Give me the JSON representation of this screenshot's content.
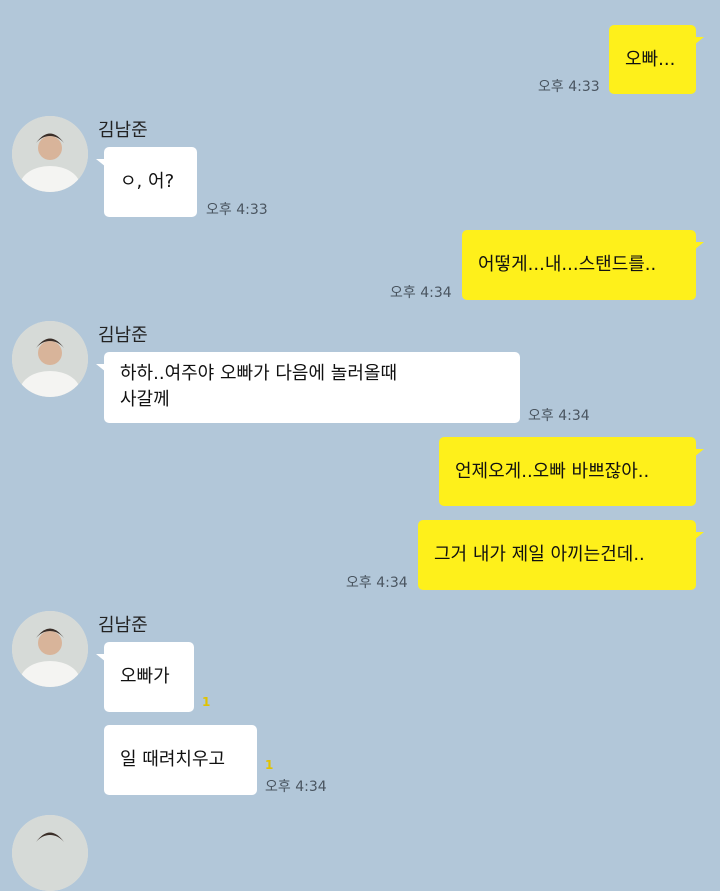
{
  "messages": [
    {
      "text": "오빠...",
      "time": "오후 4:33"
    },
    {
      "sender": "김남준",
      "text": "ㅇ, 어?",
      "time": "오후 4:33"
    },
    {
      "text": "어떻게...내...스탠드를..",
      "time": "오후 4:34"
    },
    {
      "sender": "김남준",
      "text": "하하..여주야 오빠가 다음에 놀러올때\n사갈께",
      "time": "오후 4:34"
    },
    {
      "text": "언제오게..오빠 바쁘잖아.."
    },
    {
      "text": "그거 내가 제일 아끼는건데..",
      "time": "오후 4:34"
    },
    {
      "sender": "김남준",
      "text": "오빠가",
      "unread": "1"
    },
    {
      "text": "일 때려치우고",
      "unread": "1",
      "time": "오후 4:34"
    }
  ],
  "colors": {
    "background": "#b2c7d9",
    "outgoing": "#fef01b",
    "incoming": "#ffffff"
  },
  "icons": {
    "avatar": "profile-photo"
  }
}
